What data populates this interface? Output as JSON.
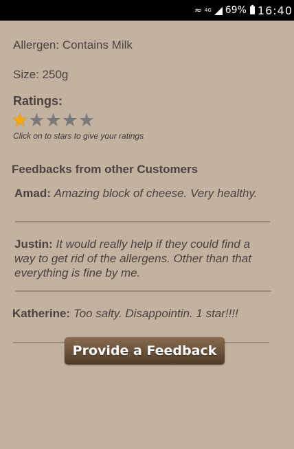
{
  "status_bar": {
    "network": "4G",
    "battery": "69%",
    "time": "16:40"
  },
  "product": {
    "allergen_label": "Allergen:",
    "allergen_value": "Contains Milk",
    "size_label": "Size:",
    "size_value": "250g"
  },
  "ratings": {
    "title": "Ratings:",
    "value": 1,
    "max": 5,
    "hint": "Click on to stars to give your ratings"
  },
  "feedback": {
    "title": "Feedbacks from other Customers",
    "items": [
      {
        "name": "Amad:",
        "text": "Amazing block of cheese. Very healthy."
      },
      {
        "name": "Justin:",
        "text": "It would really help if they could find a way to get rid of the allergens. Other than that everything is fine by me."
      },
      {
        "name": "Katherine:",
        "text": "Too salty. Disappointin. 1 star!!!!"
      }
    ]
  },
  "button": {
    "label": "Provide a Feedback"
  },
  "colors": {
    "background": "#c2b2a0",
    "text": "#4f4040",
    "star_on": "#f5a800",
    "star_off": "#7a7a7a",
    "button": "#6b5039"
  },
  "icons": {
    "wifi": "wifi-icon",
    "signal": "signal-icon",
    "battery": "battery-icon",
    "star": "star-icon"
  }
}
